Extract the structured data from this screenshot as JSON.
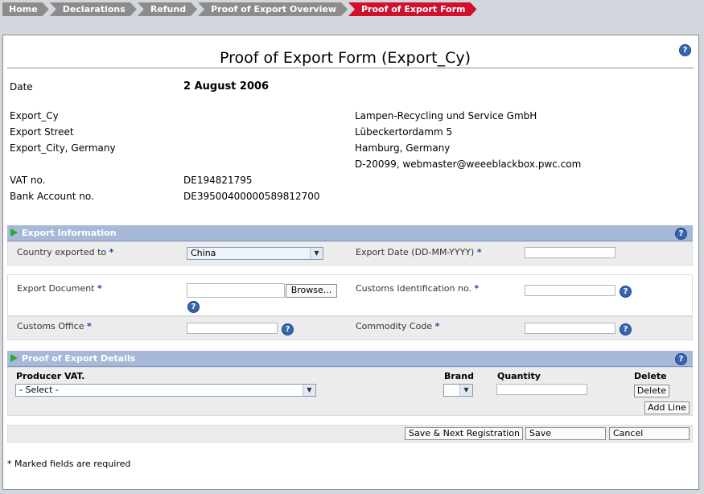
{
  "breadcrumb": [
    "Home",
    "Declarations",
    "Refund",
    "Proof of Export Overview",
    "Proof of Export Form"
  ],
  "page_title": "Proof of Export Form (Export_Cy)",
  "date_label": "Date",
  "date_value": "2 August 2006",
  "exporter": {
    "name": "Export_Cy",
    "street": "Export Street",
    "city": "Export_City, Germany"
  },
  "recipient": {
    "name": "Lampen-Recycling und Service GmbH",
    "street": "Lübeckertordamm 5",
    "city": "Hamburg, Germany",
    "contact": "D-20099, webmaster@weeeblackbox.pwc.com"
  },
  "vat_label": "VAT no.",
  "vat_value": "DE194821795",
  "bank_label": "Bank Account no.",
  "bank_value": "DE39500400000589812700",
  "export_info": {
    "header": "Export Information",
    "country_label": "Country exported to",
    "country_value": "China",
    "export_date_label": "Export Date (DD-MM-YYYY)",
    "export_document_label": "Export Document",
    "browse_label": "Browse...",
    "customs_id_label": "Customs Identification no.",
    "customs_office_label": "Customs Office",
    "commodity_code_label": "Commodity Code"
  },
  "details": {
    "header": "Proof of Export Details",
    "col_producer": "Producer VAT.",
    "col_brand": "Brand",
    "col_quantity": "Quantity",
    "col_delete": "Delete",
    "producer_select": "- Select -",
    "delete_button": "Delete",
    "add_line_button": "Add Line"
  },
  "actions": {
    "save_next": "Save & Next Registration",
    "save": "Save",
    "cancel": "Cancel"
  },
  "required_note": "* Marked fields are required",
  "required_mark": "*",
  "help_glyph": "?"
}
